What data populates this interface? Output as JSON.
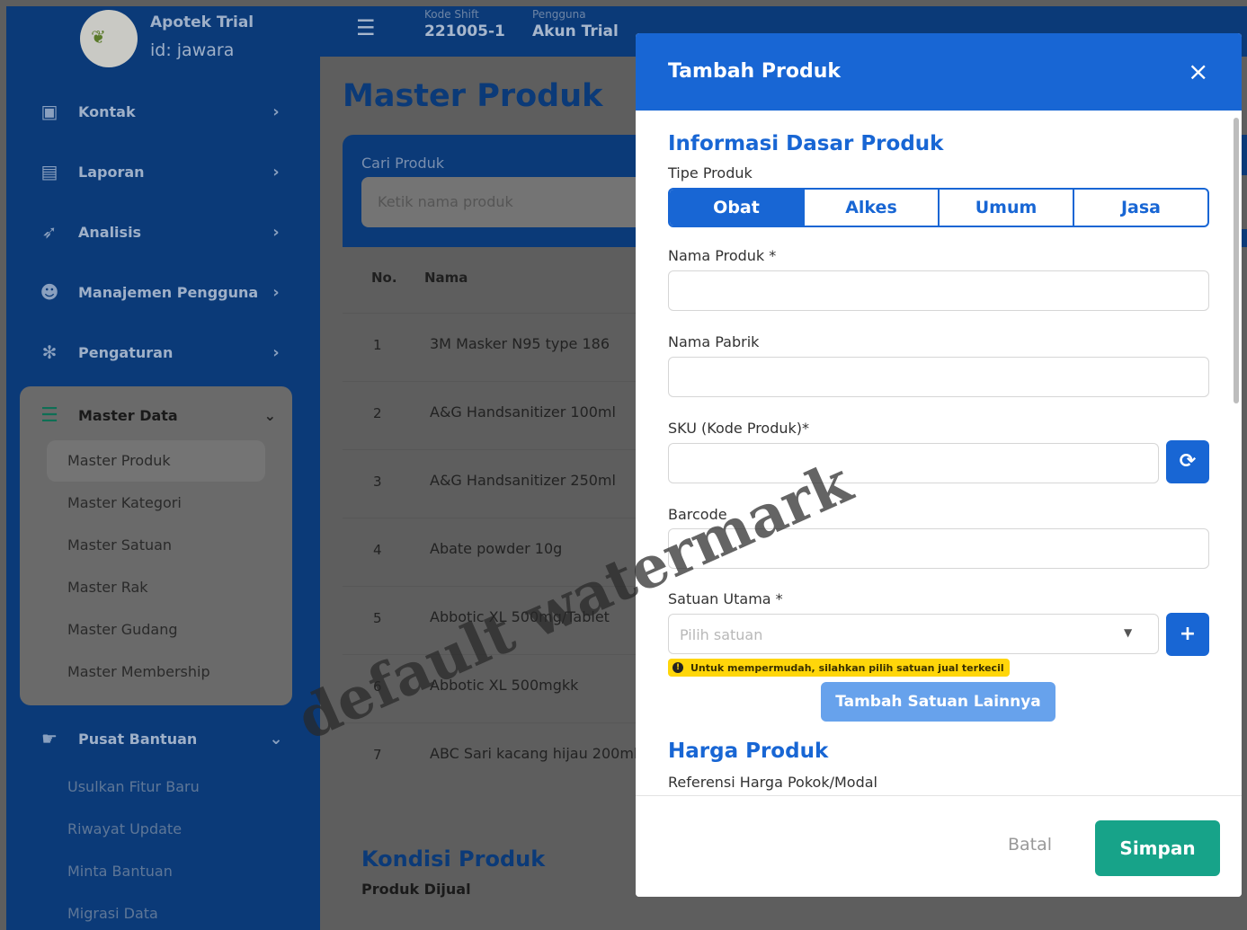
{
  "sidebar": {
    "brand_title": "Apotek Trial",
    "brand_id": "id: jawara",
    "logo_text": "jawara",
    "items": [
      {
        "label": "Kontak",
        "icon": "contact-card-icon"
      },
      {
        "label": "Laporan",
        "icon": "report-table-icon"
      },
      {
        "label": "Analisis",
        "icon": "rocket-icon"
      },
      {
        "label": "Manajemen Pengguna",
        "icon": "user-gear-icon"
      },
      {
        "label": "Pengaturan",
        "icon": "gear-icon"
      }
    ],
    "master": {
      "label": "Master Data",
      "icon": "database-icon",
      "sub": [
        "Master Produk",
        "Master Kategori",
        "Master Satuan",
        "Master Rak",
        "Master Gudang",
        "Master Membership"
      ]
    },
    "help": {
      "label": "Pusat Bantuan",
      "icon": "handshake-icon",
      "sub": [
        "Usulkan Fitur Baru",
        "Riwayat Update",
        "Minta Bantuan",
        "Migrasi Data"
      ]
    }
  },
  "topbar": {
    "shift_label": "Kode Shift",
    "shift_value": "221005-1",
    "user_label": "Pengguna",
    "user_value": "Akun Trial"
  },
  "main": {
    "title": "Master Produk",
    "search_label": "Cari Produk",
    "search_placeholder": "Ketik nama produk",
    "table_headers": [
      "No.",
      "Nama"
    ],
    "rows": [
      {
        "no": "1",
        "name": "3M Masker N95 type 186"
      },
      {
        "no": "2",
        "name": "A&G Handsanitizer 100ml"
      },
      {
        "no": "3",
        "name": "A&G Handsanitizer 250ml"
      },
      {
        "no": "4",
        "name": "Abate powder 10g"
      },
      {
        "no": "5",
        "name": "Abbotic XL 500mg/Tablet"
      },
      {
        "no": "6",
        "name": "Abbotic XL 500mgkk"
      },
      {
        "no": "7",
        "name": "ABC Sari kacang hijau 200ml"
      }
    ],
    "kondisi_title": "Kondisi Produk",
    "kondisi_sub": "Produk Dijual"
  },
  "modal": {
    "title": "Tambah Produk",
    "close": "×",
    "section_basic": "Informasi Dasar Produk",
    "tipe_label": "Tipe Produk",
    "tipe_options": [
      "Obat",
      "Alkes",
      "Umum",
      "Jasa"
    ],
    "tipe_selected": "Obat",
    "nama_label": "Nama Produk *",
    "nama_value": "",
    "pabrik_label": "Nama Pabrik",
    "pabrik_value": "",
    "sku_label": "SKU (Kode Produk)*",
    "sku_value": "",
    "barcode_label": "Barcode",
    "barcode_value": "",
    "satuan_label": "Satuan Utama *",
    "satuan_placeholder": "Pilih satuan",
    "hint": "Untuk mempermudah, silahkan pilih satuan jual terkecil",
    "add_unit": "Tambah Satuan Lainnya",
    "section_price": "Harga Produk",
    "price_ref_label": "Referensi Harga Pokok/Modal",
    "cancel": "Batal",
    "save": "Simpan",
    "accent_color": "#1866d4",
    "save_color": "#17a389",
    "hint_color": "#ffd60a"
  },
  "watermark": "default watermark"
}
